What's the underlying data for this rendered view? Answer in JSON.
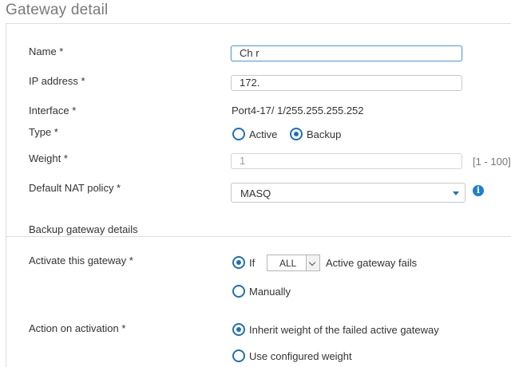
{
  "header": {
    "title": "Gateway detail"
  },
  "form": {
    "name": {
      "label": "Name *",
      "value": "Ch        r"
    },
    "ip": {
      "label": "IP address *",
      "value": "172.    "
    },
    "interface": {
      "label": "Interface *",
      "value": "Port4-17/      1/255.255.255.252"
    },
    "type": {
      "label": "Type *",
      "options": [
        "Active",
        "Backup"
      ],
      "selected": "Backup"
    },
    "weight": {
      "label": "Weight *",
      "value": "1",
      "range": "[1 - 100]"
    },
    "nat": {
      "label": "Default NAT policy *",
      "value": "MASQ"
    }
  },
  "backup": {
    "section_title": "Backup gateway details",
    "activate": {
      "label": "Activate this gateway *",
      "if_label": "If",
      "condition_value": "ALL",
      "fails_label": "Active gateway fails",
      "manual_label": "Manually",
      "selected": "If"
    },
    "action": {
      "label": "Action on activation *",
      "inherit_label": "Inherit weight of the failed active gateway",
      "configured_label": "Use configured weight",
      "selected": "Inherit weight of the failed active gateway"
    }
  },
  "colors": {
    "accent": "#1f6fb3",
    "info": "#1e7fd0",
    "focus_border": "#5aa0d8"
  },
  "icons": {
    "info": "info-icon",
    "dropdown": "chevron-down-icon"
  }
}
